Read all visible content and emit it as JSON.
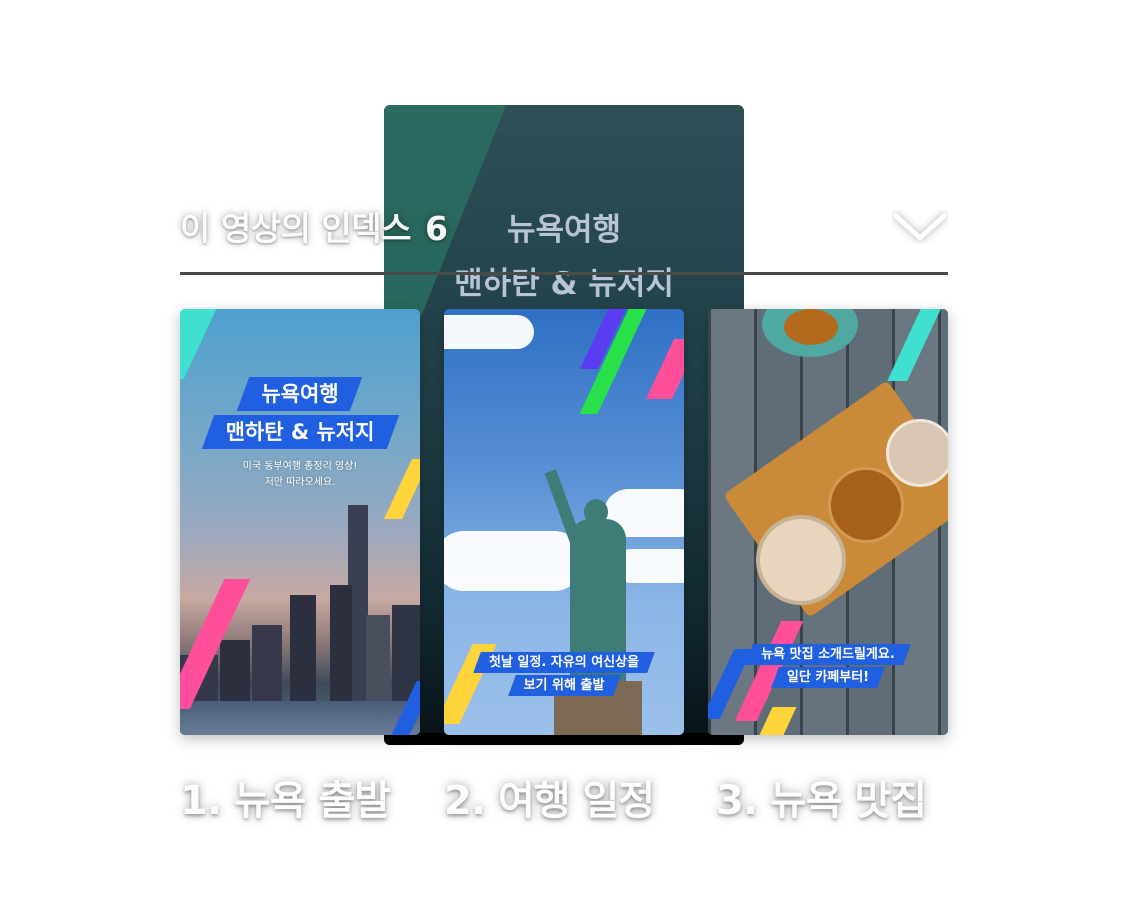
{
  "background_frame": {
    "title_line1": "뉴욕여행",
    "title_line2": "맨하탄 & 뉴저지"
  },
  "header": {
    "title": "이 영상의 인덱스",
    "count": "6",
    "toggle_icon": "chevron-down-icon"
  },
  "cards": [
    {
      "title_line1": "뉴욕여행",
      "title_line2": "맨하탄 & 뉴저지",
      "subtitle_line1": "미국 동부여행 총정리 영상!",
      "subtitle_line2": "저만 따라오세요.",
      "label": "1. 뉴욕 출발"
    },
    {
      "caption_line1": "첫날 일정. 자유의 여신상을",
      "caption_line2": "보기 위해 출발",
      "label": "2. 여행 일정"
    },
    {
      "caption_line1": "뉴욕 맛집 소개드릴게요.",
      "caption_line2": "일단 카페부터!",
      "label": "3. 뉴욕 맛집"
    }
  ],
  "colors": {
    "accent_blue": "#1f5fe0",
    "divider": "#4a4a4a",
    "stripe_pink": "#ff4f9a",
    "stripe_yellow": "#ffd43b",
    "stripe_cyan": "#3fe0d0",
    "stripe_green": "#27e04a",
    "stripe_violet": "#5a3df0"
  }
}
